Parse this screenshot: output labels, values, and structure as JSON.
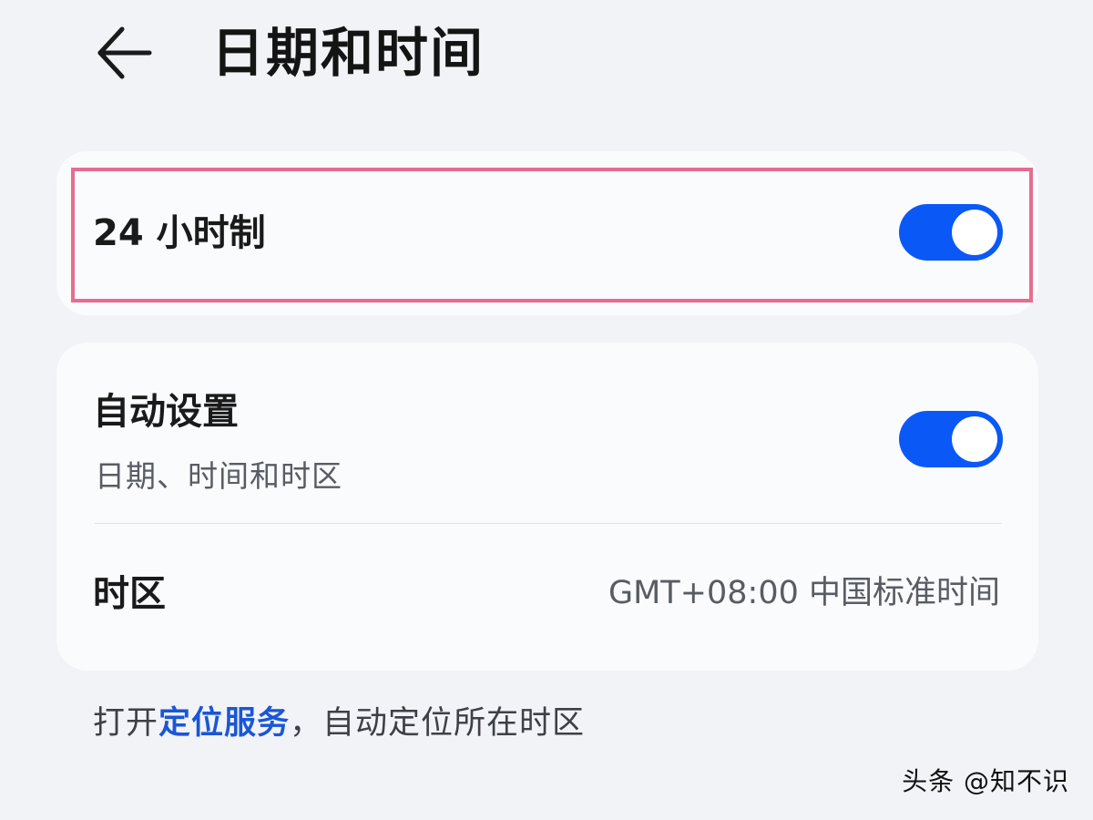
{
  "header": {
    "back_icon": "arrow-left-icon",
    "title": "日期和时间"
  },
  "settings": {
    "hour_format": {
      "label": "24 小时制",
      "enabled": true
    },
    "auto_set": {
      "label": "自动设置",
      "sublabel": "日期、时间和时区",
      "enabled": true
    },
    "timezone": {
      "label": "时区",
      "value": "GMT+08:00 中国标准时间"
    }
  },
  "footer": {
    "prefix": "打开",
    "link_text": "定位服务",
    "suffix": "，自动定位所在时区"
  },
  "watermark": {
    "text": "头条 @知不识"
  },
  "colors": {
    "background": "#f1f3f7",
    "card": "#fafbfd",
    "accent": "#0a59f7",
    "highlight_border": "#e66c90",
    "link": "#1a56d6"
  }
}
